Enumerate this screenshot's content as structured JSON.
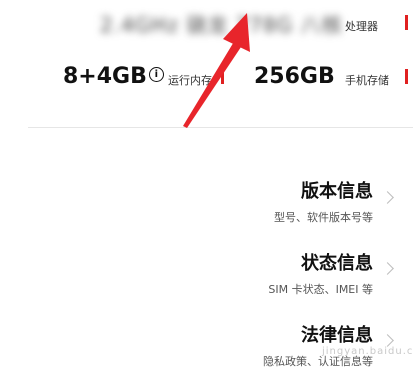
{
  "processor": {
    "value": "2.4GHz 骁龙 778G 八核",
    "label": "处理器"
  },
  "memory": {
    "value": "8+4GB",
    "label": "运行内存"
  },
  "storage": {
    "value": "256GB",
    "label": "手机存储"
  },
  "items": [
    {
      "title": "版本信息",
      "subtitle": "型号、软件版本号等"
    },
    {
      "title": "状态信息",
      "subtitle": "SIM 卡状态、IMEI 等"
    },
    {
      "title": "法律信息",
      "subtitle": "隐私政策、认证信息等"
    }
  ],
  "watermark": "jingyan.baidu.com",
  "colors": {
    "accent_bar": "#e02020",
    "annotation_arrow": "#e8252b"
  }
}
